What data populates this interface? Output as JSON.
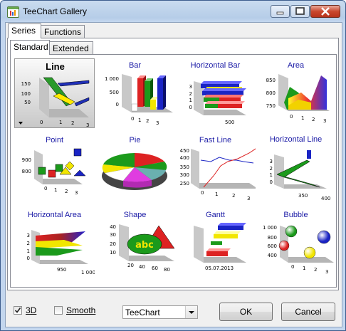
{
  "window": {
    "title": "TeeChart Gallery"
  },
  "tabs": [
    {
      "label": "Series",
      "active": true
    },
    {
      "label": "Functions",
      "active": false
    }
  ],
  "subtabs": [
    {
      "label": "Standard",
      "active": true
    },
    {
      "label": "Extended",
      "active": false
    }
  ],
  "gallery": [
    {
      "label": "Line",
      "selected": true,
      "ticks_y": [
        "150",
        "100",
        "50"
      ],
      "ticks_x": [
        "0",
        "1",
        "2",
        "3"
      ]
    },
    {
      "label": "Bar",
      "ticks_y": [
        "1 000",
        "500",
        "0"
      ],
      "ticks_x": [
        "0",
        "1",
        "2",
        "3"
      ]
    },
    {
      "label": "Horizontal Bar",
      "ticks_y": [
        "3",
        "2",
        "1",
        "0"
      ],
      "ticks_x": [
        "500"
      ]
    },
    {
      "label": "Area",
      "ticks_y": [
        "850",
        "800",
        "750"
      ],
      "ticks_x": [
        "0",
        "1",
        "2",
        "3"
      ]
    },
    {
      "label": "Point",
      "ticks_y": [
        "900",
        "800"
      ],
      "ticks_x": [
        "0",
        "1",
        "2",
        "3"
      ]
    },
    {
      "label": "Pie"
    },
    {
      "label": "Fast Line",
      "ticks_y": [
        "450",
        "400",
        "350",
        "300",
        "250"
      ],
      "ticks_x": [
        "0",
        "1",
        "2",
        "3"
      ]
    },
    {
      "label": "Horizontal Line",
      "ticks_y": [
        "3",
        "2",
        "1",
        "0"
      ],
      "ticks_x": [
        "350",
        "400"
      ]
    },
    {
      "label": "Horizontal Area",
      "ticks_y": [
        "3",
        "2",
        "1",
        "0"
      ],
      "ticks_x": [
        "950",
        "1 000"
      ]
    },
    {
      "label": "Shape",
      "ticks_y": [
        "40",
        "30",
        "20",
        "10"
      ],
      "ticks_x": [
        "20",
        "40",
        "60",
        "80"
      ],
      "text": "abc"
    },
    {
      "label": "Gantt",
      "ticks_y": [],
      "ticks_x": [
        "05.07.2013"
      ]
    },
    {
      "label": "Bubble",
      "ticks_y": [
        "1 000",
        "800",
        "600",
        "400"
      ],
      "ticks_x": [
        "0",
        "1",
        "2",
        "3"
      ]
    }
  ],
  "options": {
    "3d_label": "3D",
    "3d_checked": true,
    "smooth_label": "Smooth",
    "smooth_checked": false
  },
  "style_select": {
    "value": "TeeChart"
  },
  "buttons": {
    "ok": "OK",
    "cancel": "Cancel"
  }
}
